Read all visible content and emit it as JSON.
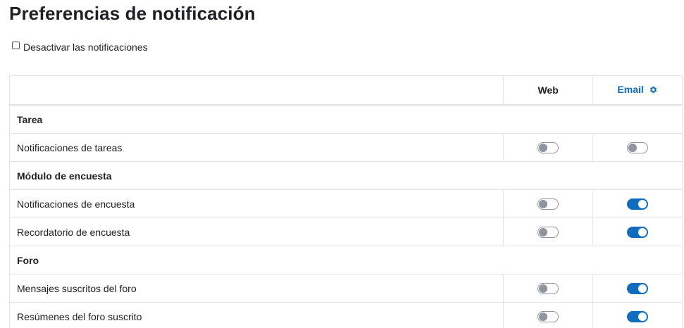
{
  "page": {
    "title": "Preferencias de notificación"
  },
  "disable_all": {
    "label": "Desactivar las notificaciones",
    "checked": false
  },
  "table": {
    "columns": {
      "web": "Web",
      "email": "Email",
      "email_icon": "gear-icon"
    },
    "sections": [
      {
        "title": "Tarea",
        "items": [
          {
            "label": "Notificaciones de tareas",
            "web": false,
            "email": false
          }
        ]
      },
      {
        "title": "Módulo de encuesta",
        "items": [
          {
            "label": "Notificaciones de encuesta",
            "web": false,
            "email": true
          },
          {
            "label": "Recordatorio de encuesta",
            "web": false,
            "email": true
          }
        ]
      },
      {
        "title": "Foro",
        "items": [
          {
            "label": "Mensajes suscritos del foro",
            "web": false,
            "email": true
          },
          {
            "label": "Resúmenes del foro suscrito",
            "web": false,
            "email": true
          }
        ]
      }
    ]
  },
  "colors": {
    "accent": "#0f6cbf",
    "toggle_off": "#8f959e",
    "text": "#1d2125",
    "border": "#e4e6e8"
  }
}
